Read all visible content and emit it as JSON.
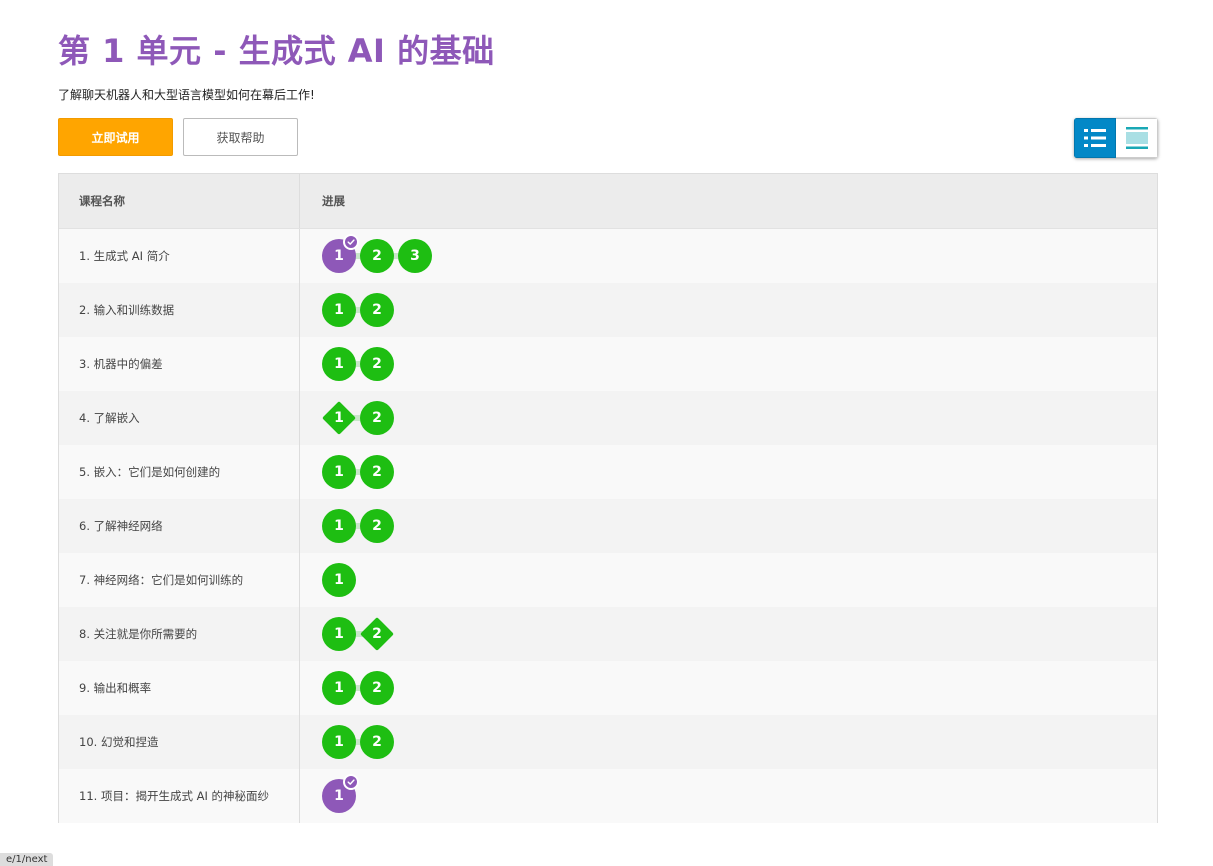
{
  "page": {
    "title": "第 1 单元 - 生成式 AI 的基础",
    "subtitle": "了解聊天机器人和大型语言模型如何在幕后工作!"
  },
  "buttons": {
    "try_now": "立即试用",
    "get_help": "获取帮助"
  },
  "view_toggle": {
    "list_icon": "list-icon",
    "grid_icon": "grid-icon"
  },
  "table": {
    "headers": {
      "name": "课程名称",
      "progress": "进展"
    },
    "rows": [
      {
        "name": "1. 生成式 AI 简介",
        "steps": [
          {
            "label": "1",
            "state": "done"
          },
          {
            "label": "2",
            "state": "circle"
          },
          {
            "label": "3",
            "state": "circle"
          }
        ]
      },
      {
        "name": "2. 输入和训练数据",
        "steps": [
          {
            "label": "1",
            "state": "circle"
          },
          {
            "label": "2",
            "state": "circle"
          }
        ]
      },
      {
        "name": "3. 机器中的偏差",
        "steps": [
          {
            "label": "1",
            "state": "circle"
          },
          {
            "label": "2",
            "state": "circle"
          }
        ]
      },
      {
        "name": "4. 了解嵌入",
        "steps": [
          {
            "label": "1",
            "state": "diamond"
          },
          {
            "label": "2",
            "state": "circle"
          }
        ]
      },
      {
        "name": "5. 嵌入：它们是如何创建的",
        "steps": [
          {
            "label": "1",
            "state": "circle"
          },
          {
            "label": "2",
            "state": "circle"
          }
        ]
      },
      {
        "name": "6. 了解神经网络",
        "steps": [
          {
            "label": "1",
            "state": "circle"
          },
          {
            "label": "2",
            "state": "circle"
          }
        ]
      },
      {
        "name": "7. 神经网络：它们是如何训练的",
        "steps": [
          {
            "label": "1",
            "state": "circle"
          }
        ]
      },
      {
        "name": "8. 关注就是你所需要的",
        "steps": [
          {
            "label": "1",
            "state": "circle"
          },
          {
            "label": "2",
            "state": "diamond"
          }
        ]
      },
      {
        "name": "9. 输出和概率",
        "steps": [
          {
            "label": "1",
            "state": "circle"
          },
          {
            "label": "2",
            "state": "circle"
          }
        ]
      },
      {
        "name": "10. 幻觉和捏造",
        "steps": [
          {
            "label": "1",
            "state": "circle"
          },
          {
            "label": "2",
            "state": "circle"
          }
        ]
      },
      {
        "name": "11. 项目：揭开生成式 AI 的神秘面纱",
        "steps": [
          {
            "label": "1",
            "state": "done"
          }
        ]
      }
    ]
  },
  "colors": {
    "title": "#8e58b8",
    "primary_button": "#ffa500",
    "step_active": "#1ebe12",
    "step_done": "#8e58b8",
    "toggle_active": "#0288c7"
  },
  "footer": {
    "badge": "e/1/next"
  }
}
